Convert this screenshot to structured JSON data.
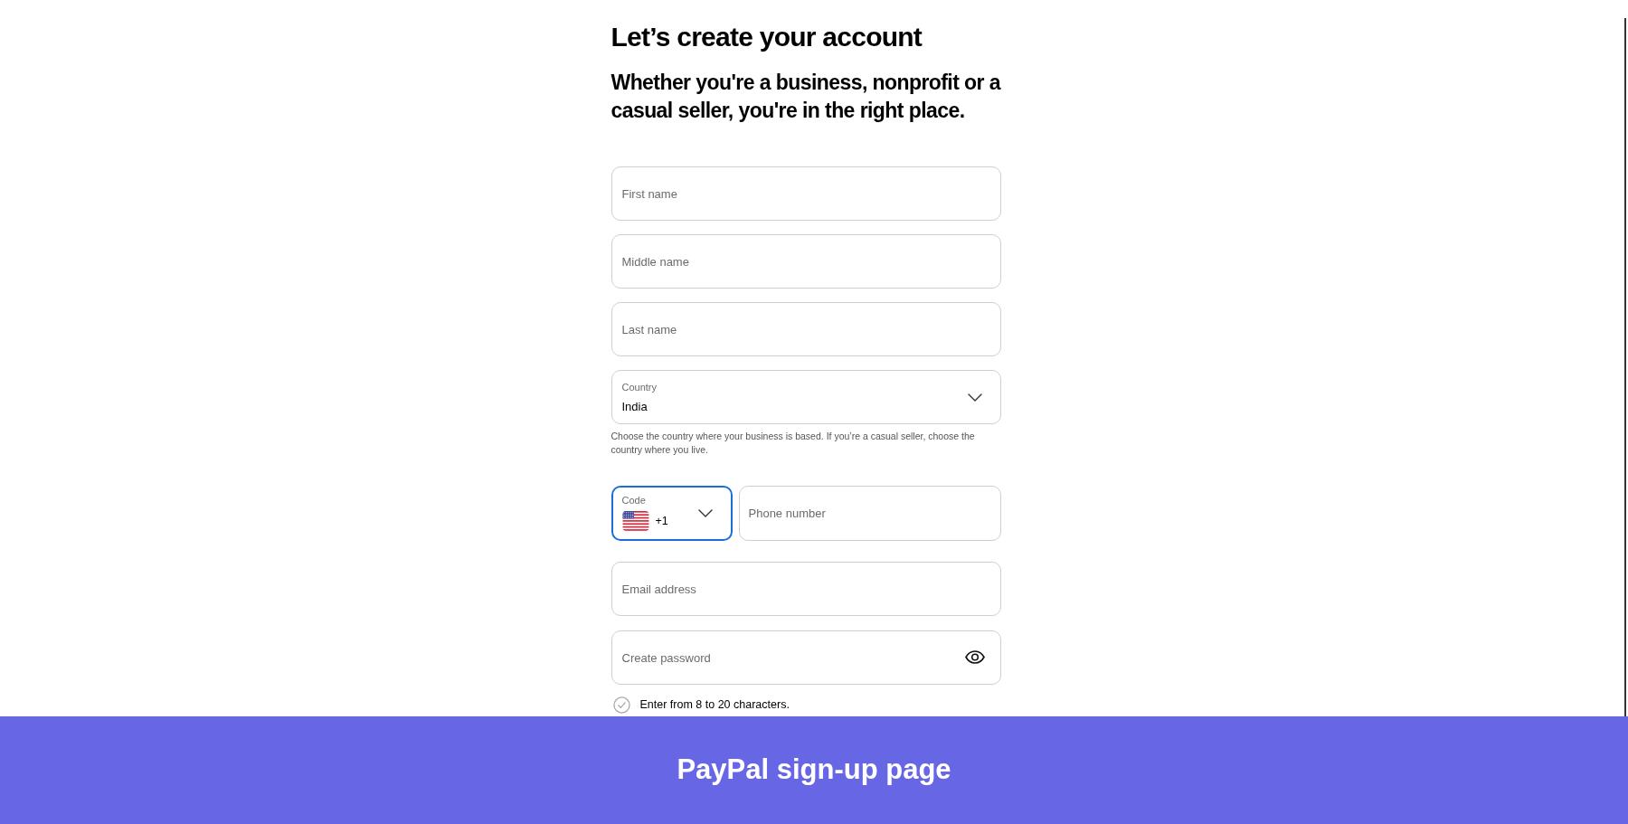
{
  "page": {
    "heading": "Let’s create your account",
    "subheading": "Whether you're a business, nonprofit or a casual seller, you're in the right place."
  },
  "fields": [
    {
      "kind": "text",
      "placeholder": "First name"
    },
    {
      "kind": "text",
      "placeholder": "Middle name"
    },
    {
      "kind": "text",
      "placeholder": "Last name"
    },
    {
      "kind": "select",
      "label": "Country",
      "value": "India",
      "help": "Choose the country where your business is based. If you’re a casual seller, choose the country where you live."
    },
    {
      "kind": "phone",
      "code": {
        "label": "Code",
        "value": "+1",
        "focused": true
      },
      "placeholder": "Phone number"
    },
    {
      "kind": "text",
      "placeholder": "Email address"
    },
    {
      "kind": "password",
      "placeholder": "Create password"
    }
  ],
  "password_rules": [
    {
      "text": "Enter from 8 to 20 characters.",
      "met": false
    }
  ],
  "caption": "PayPal sign-up page"
}
